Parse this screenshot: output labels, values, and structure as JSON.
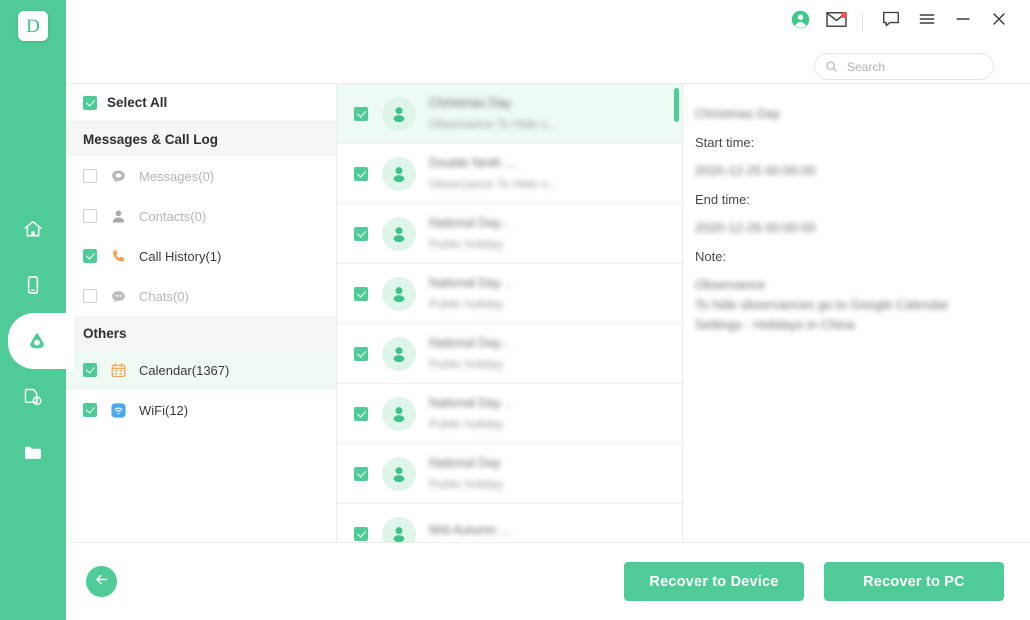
{
  "brand": {
    "logo_letter": "D",
    "accent_color": "#4ECB96",
    "rail_color": "#4ECB96"
  },
  "titlebar": {
    "icons": [
      {
        "name": "account-icon",
        "label": "Account"
      },
      {
        "name": "mail-icon",
        "label": "Messages",
        "has_badge": true
      },
      {
        "name": "feedback-icon",
        "label": "Feedback"
      },
      {
        "name": "menu-icon",
        "label": "Menu"
      },
      {
        "name": "minimize-icon",
        "label": "Minimize"
      },
      {
        "name": "close-icon",
        "label": "Close"
      }
    ]
  },
  "search": {
    "placeholder": "Search",
    "value": "",
    "icon": "search-icon"
  },
  "rail": {
    "items": [
      {
        "name": "home-icon",
        "label": "Home",
        "active": false
      },
      {
        "name": "device-icon",
        "label": "Device",
        "active": false
      },
      {
        "name": "cloud-icon",
        "label": "Cloud Recovery",
        "active": true
      },
      {
        "name": "repair-icon",
        "label": "System Repair",
        "active": false
      },
      {
        "name": "folder-icon",
        "label": "Files",
        "active": false
      }
    ]
  },
  "categories": {
    "select_all_label": "Select All",
    "select_all_checked": true,
    "groups": [
      {
        "title": "Messages & Call Log",
        "items": [
          {
            "label": "Messages(0)",
            "icon": "message-icon",
            "checked": false,
            "disabled": true,
            "selected": false
          },
          {
            "label": "Contacts(0)",
            "icon": "contact-icon",
            "checked": false,
            "disabled": true,
            "selected": false
          },
          {
            "label": "Call History(1)",
            "icon": "phone-icon",
            "checked": true,
            "disabled": false,
            "selected": false
          },
          {
            "label": "Chats(0)",
            "icon": "chat-icon",
            "checked": false,
            "disabled": true,
            "selected": false
          }
        ]
      },
      {
        "title": "Others",
        "items": [
          {
            "label": "Calendar(1367)",
            "icon": "calendar-icon",
            "checked": true,
            "disabled": false,
            "selected": true
          },
          {
            "label": "WiFi(12)",
            "icon": "wifi-icon",
            "checked": true,
            "disabled": false,
            "selected": false
          }
        ]
      }
    ]
  },
  "list": {
    "scroll_position": "top",
    "items": [
      {
        "title": "Christmas Day",
        "subtitle": "Observance To Hide s...",
        "checked": true,
        "selected": true,
        "redacted": true
      },
      {
        "title": "Double Ninth ...",
        "subtitle": "Observance To Hide o...",
        "checked": true,
        "selected": false,
        "redacted": true
      },
      {
        "title": "National Day...",
        "subtitle": "Public holiday",
        "checked": true,
        "selected": false,
        "redacted": true
      },
      {
        "title": "National Day ..",
        "subtitle": "Public holiday",
        "checked": true,
        "selected": false,
        "redacted": true
      },
      {
        "title": "National Day...",
        "subtitle": "Public holiday",
        "checked": true,
        "selected": false,
        "redacted": true
      },
      {
        "title": "National Day ..",
        "subtitle": "Public holiday",
        "checked": true,
        "selected": false,
        "redacted": true
      },
      {
        "title": "National Day",
        "subtitle": "Public holiday",
        "checked": true,
        "selected": false,
        "redacted": true
      },
      {
        "title": "Mid-Autumn ...",
        "subtitle": "",
        "checked": true,
        "selected": false,
        "redacted": true
      }
    ]
  },
  "detail": {
    "title": "Christmas Day",
    "title_redacted": true,
    "fields": [
      {
        "label": "Start time:",
        "value": "2020-12-25 00:00:00",
        "value_redacted": true
      },
      {
        "label": "End time:",
        "value": "2020-12-26 00:00:00",
        "value_redacted": true
      }
    ],
    "note_label": "Note:",
    "note_lines": [
      "Observance",
      "To hide observances go to Google Calendar",
      "Settings - Holidays in China",
      ""
    ],
    "note_redacted": true
  },
  "footer": {
    "back_label": "Back",
    "back_icon": "arrow-left-icon",
    "recover_to_device_label": "Recover to Device",
    "recover_to_pc_label": "Recover to PC"
  }
}
